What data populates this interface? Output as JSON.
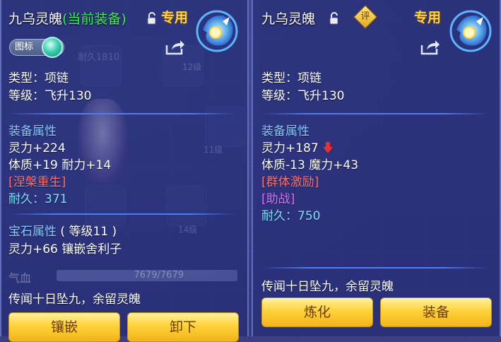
{
  "left_panel": {
    "name": "九乌灵魄",
    "equipped_tag": "(当前装备)",
    "exclusive": "专用",
    "icon_toggle": "图标",
    "type": "类型：项链",
    "level": "等级：飞升130",
    "attr_header": "装备属性",
    "attr1": "灵力+224",
    "attr2": "体质+19 耐力+14",
    "special": "[涅槃重生]",
    "durability": "耐久：371",
    "gem_header": "宝石属性",
    "gem_level": "( 等级11 )",
    "gem_attr": "灵力+66 镶嵌舍利子",
    "lore": "传闻十日坠九，余留灵魄",
    "btn1": "镶嵌",
    "btn2": "卸下",
    "bg_blood_label": "气血",
    "bg_blood_value": "7679/7679"
  },
  "right_panel": {
    "name": "九乌灵魄",
    "review_badge": "评",
    "exclusive": "专用",
    "type": "类型：项链",
    "level": "等级：飞升130",
    "attr_header": "装备属性",
    "attr1": "灵力+187",
    "attr2": "体质-13 魔力+43",
    "special": "[群体激励]",
    "skill": "[助战]",
    "durability": "耐久：750",
    "lore": "传闻十日坠九，余留灵魄",
    "btn1": "炼化",
    "btn2": "装备"
  },
  "background_fragments": {
    "durability_left": "耐久1810",
    "slot_levels": [
      "12级",
      "11级",
      "14级"
    ]
  },
  "colors": {
    "equipped": "#3cf05a",
    "section": "#8ec7ff",
    "special": "#ff7070",
    "durability": "#7fe0ff",
    "skill": "#e26bff",
    "exclusive": "#ffd43b"
  }
}
